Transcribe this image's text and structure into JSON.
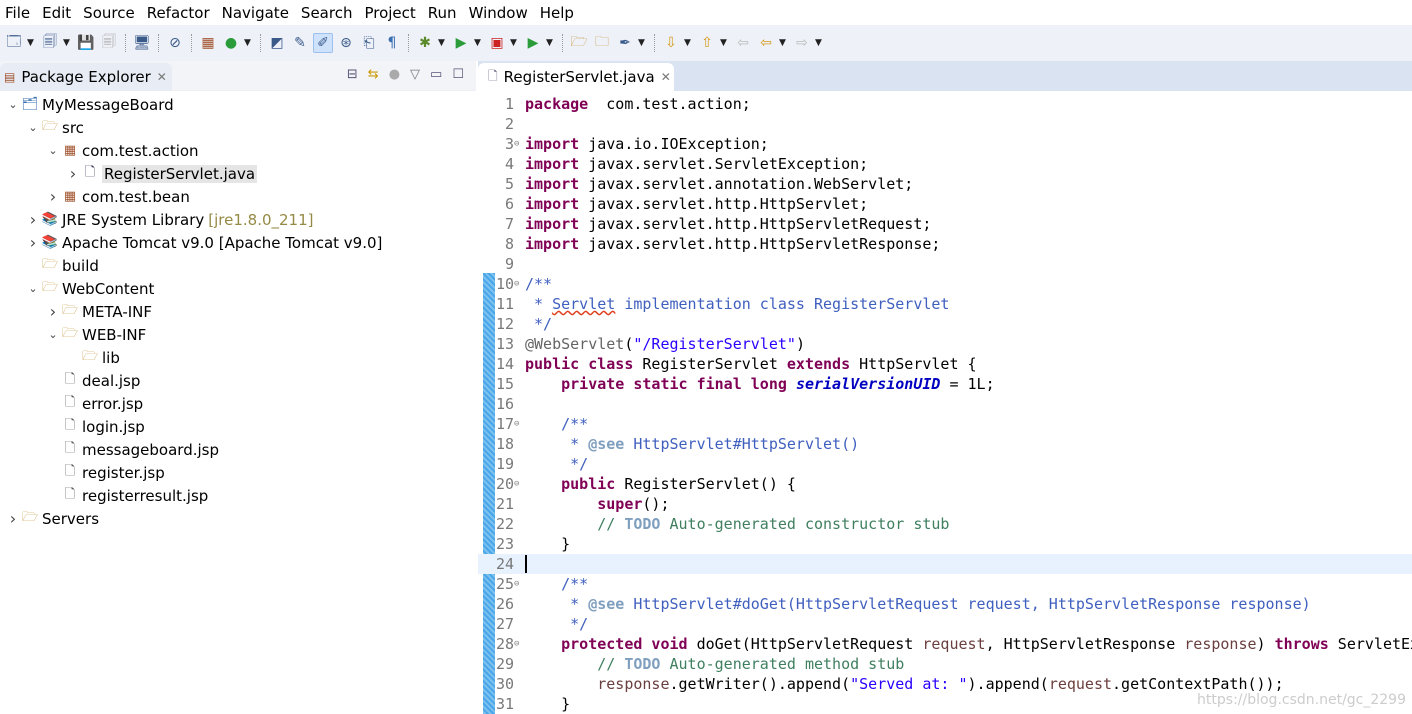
{
  "menu": [
    "File",
    "Edit",
    "Source",
    "Refactor",
    "Navigate",
    "Search",
    "Project",
    "Run",
    "Window",
    "Help"
  ],
  "toolbar": {
    "icons": [
      "new-wizard-icon",
      "new-project-icon",
      "save-icon",
      "save-all-icon",
      "console-icon",
      "skip-breakpoints-icon",
      "new-package-icon",
      "new-class-icon",
      "open-type-icon",
      "toggle-mark-occurrences-icon",
      "toggle-block-selection-icon",
      "next-annotation-icon",
      "prev-edit-icon",
      "show-whitespace-icon",
      "debug-icon",
      "run-icon",
      "coverage-icon",
      "external-tools-icon",
      "open-folder-icon",
      "open-file-icon",
      "pen-icon",
      "next-icon",
      "prev-icon",
      "last-edit-icon",
      "back-icon",
      "forward-icon"
    ],
    "active": "toggle-block-selection-icon"
  },
  "package_explorer": {
    "title": "Package Explorer",
    "tree": [
      {
        "label": "MyMessageBoard",
        "depth": 0,
        "arrow": "open",
        "icon": "project-icon"
      },
      {
        "label": "src",
        "depth": 1,
        "arrow": "open",
        "icon": "source-folder-icon"
      },
      {
        "label": "com.test.action",
        "depth": 2,
        "arrow": "open",
        "icon": "package-icon"
      },
      {
        "label": "RegisterServlet.java",
        "depth": 3,
        "arrow": "closed",
        "icon": "java-file-icon",
        "selected": true
      },
      {
        "label": "com.test.bean",
        "depth": 2,
        "arrow": "closed",
        "icon": "package-icon"
      },
      {
        "label": "JRE System Library",
        "deco": "[jre1.8.0_211]",
        "depth": 1,
        "arrow": "closed",
        "icon": "library-icon"
      },
      {
        "label": "Apache Tomcat v9.0 [Apache Tomcat v9.0]",
        "depth": 1,
        "arrow": "closed",
        "icon": "library-icon"
      },
      {
        "label": "build",
        "depth": 1,
        "arrow": "none",
        "icon": "folder-icon"
      },
      {
        "label": "WebContent",
        "depth": 1,
        "arrow": "open",
        "icon": "folder-icon"
      },
      {
        "label": "META-INF",
        "depth": 2,
        "arrow": "closed",
        "icon": "folder-icon"
      },
      {
        "label": "WEB-INF",
        "depth": 2,
        "arrow": "open",
        "icon": "folder-icon"
      },
      {
        "label": "lib",
        "depth": 3,
        "arrow": "none",
        "icon": "folder-icon"
      },
      {
        "label": "deal.jsp",
        "depth": 2,
        "arrow": "none",
        "icon": "file-icon"
      },
      {
        "label": "error.jsp",
        "depth": 2,
        "arrow": "none",
        "icon": "file-icon"
      },
      {
        "label": "login.jsp",
        "depth": 2,
        "arrow": "none",
        "icon": "file-icon"
      },
      {
        "label": "messageboard.jsp",
        "depth": 2,
        "arrow": "none",
        "icon": "file-icon"
      },
      {
        "label": "register.jsp",
        "depth": 2,
        "arrow": "none",
        "icon": "file-icon"
      },
      {
        "label": "registerresult.jsp",
        "depth": 2,
        "arrow": "none",
        "icon": "file-icon"
      },
      {
        "label": "Servers",
        "depth": 0,
        "arrow": "closed",
        "icon": "folder-icon"
      }
    ]
  },
  "editor": {
    "tab": "RegisterServlet.java",
    "current_line": 24,
    "folds": [
      3,
      10,
      17,
      20,
      25,
      28
    ],
    "lines": [
      [
        [
          "kw",
          "package"
        ],
        [
          "",
          "  com.test.action;"
        ]
      ],
      [],
      [
        [
          "kw",
          "import"
        ],
        [
          "",
          " java.io.IOException;"
        ]
      ],
      [
        [
          "kw",
          "import"
        ],
        [
          "",
          " javax.servlet.ServletException;"
        ]
      ],
      [
        [
          "kw",
          "import"
        ],
        [
          "",
          " javax.servlet.annotation.WebServlet;"
        ]
      ],
      [
        [
          "kw",
          "import"
        ],
        [
          "",
          " javax.servlet.http.HttpServlet;"
        ]
      ],
      [
        [
          "kw",
          "import"
        ],
        [
          "",
          " javax.servlet.http.HttpServletRequest;"
        ]
      ],
      [
        [
          "kw",
          "import"
        ],
        [
          "",
          " javax.servlet.http.HttpServletResponse;"
        ]
      ],
      [],
      [
        [
          "jd",
          "/**"
        ]
      ],
      [
        [
          "jd",
          " * "
        ],
        [
          "jd sp",
          "Servlet"
        ],
        [
          "jd",
          " implementation class RegisterServlet"
        ]
      ],
      [
        [
          "jd",
          " */"
        ]
      ],
      [
        [
          "an",
          "@WebServlet"
        ],
        [
          "",
          "("
        ],
        [
          "st",
          "\"/RegisterServlet\""
        ],
        [
          "",
          ")"
        ]
      ],
      [
        [
          "kw",
          "public class"
        ],
        [
          "",
          " RegisterServlet "
        ],
        [
          "kw",
          "extends"
        ],
        [
          "",
          " HttpServlet {"
        ]
      ],
      [
        [
          "",
          "    "
        ],
        [
          "kw",
          "private static final long"
        ],
        [
          "",
          " "
        ],
        [
          "fd",
          "serialVersionUID"
        ],
        [
          "",
          " = 1L;"
        ]
      ],
      [],
      [
        [
          "jd",
          "    /**"
        ]
      ],
      [
        [
          "jd",
          "     * "
        ],
        [
          "jt",
          "@see"
        ],
        [
          "jd",
          " HttpServlet#HttpServlet()"
        ]
      ],
      [
        [
          "jd",
          "     */"
        ]
      ],
      [
        [
          "",
          "    "
        ],
        [
          "kw",
          "public"
        ],
        [
          "",
          " RegisterServlet() {"
        ]
      ],
      [
        [
          "",
          "        "
        ],
        [
          "kw",
          "super"
        ],
        [
          "",
          "();"
        ]
      ],
      [
        [
          "cm",
          "        // "
        ],
        [
          "todo",
          "TODO"
        ],
        [
          "cm",
          " Auto-generated constructor stub"
        ]
      ],
      [
        [
          "",
          "    }"
        ]
      ],
      [],
      [
        [
          "jd",
          "    /**"
        ]
      ],
      [
        [
          "jd",
          "     * "
        ],
        [
          "jt",
          "@see"
        ],
        [
          "jd",
          " HttpServlet#doGet(HttpServletRequest request, HttpServletResponse response)"
        ]
      ],
      [
        [
          "jd",
          "     */"
        ]
      ],
      [
        [
          "",
          "    "
        ],
        [
          "kw",
          "protected void"
        ],
        [
          "",
          " doGet(HttpServletRequest "
        ],
        [
          "pm",
          "request"
        ],
        [
          "",
          ", HttpServletResponse "
        ],
        [
          "pm",
          "response"
        ],
        [
          "",
          ") "
        ],
        [
          "kw",
          "throws"
        ],
        [
          "",
          " ServletException, IOException {"
        ]
      ],
      [
        [
          "cm",
          "        // "
        ],
        [
          "todo",
          "TODO"
        ],
        [
          "cm",
          " Auto-generated method stub"
        ]
      ],
      [
        [
          "",
          "        "
        ],
        [
          "pm",
          "response"
        ],
        [
          ".getWriter().append(",
          ""
        ],
        [
          "st",
          "\"Served at: \""
        ],
        [
          "",
          ").append("
        ],
        [
          "pm",
          "request"
        ],
        [
          "",
          ".getContextPath());"
        ]
      ],
      [
        [
          "",
          "    }"
        ]
      ]
    ]
  },
  "watermark": "https://blog.csdn.net/gc_2299"
}
